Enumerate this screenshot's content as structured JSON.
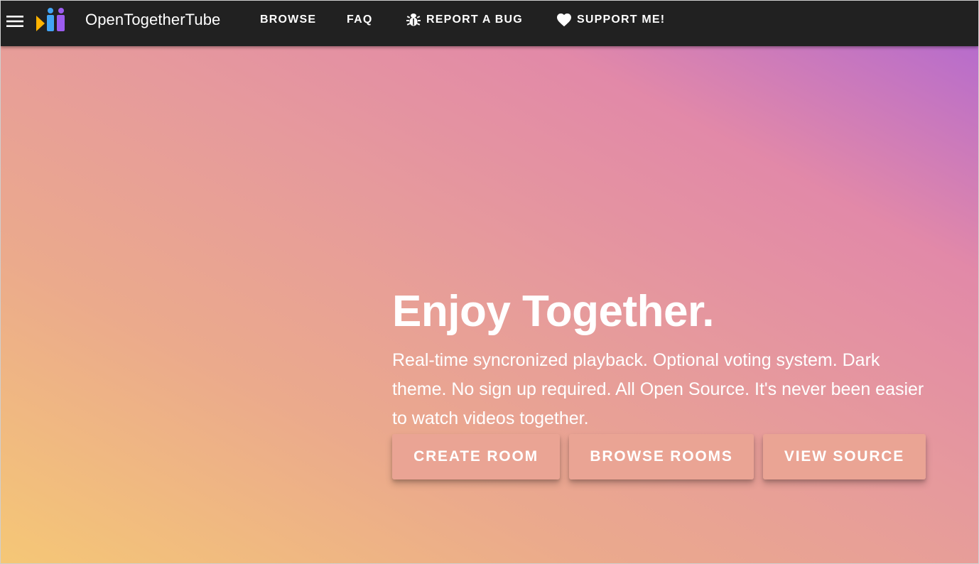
{
  "app": {
    "brand": "OpenTogetherTube"
  },
  "nav": {
    "browse": "BROWSE",
    "faq": "FAQ",
    "report_bug": "REPORT A BUG",
    "support": "SUPPORT ME!"
  },
  "icons": {
    "menu": "hamburger-menu-icon",
    "logo": "opentogethertube-logo",
    "bug": "bug-icon",
    "heart": "heart-icon"
  },
  "hero": {
    "title": "Enjoy Together.",
    "subtitle": "Real-time syncronized playback. Optional voting system. Dark theme. No sign up required. All Open Source. It's never been easier to watch videos together.",
    "buttons": {
      "create_room": "CREATE ROOM",
      "browse_rooms": "BROWSE ROOMS",
      "view_source": "VIEW SOURCE"
    }
  },
  "colors": {
    "topbar": "#212121",
    "gradient_start": "#f5c776",
    "gradient_mid": "#e69a9c",
    "gradient_end": "#b76ccc",
    "button_bg": "#eaa494",
    "logo_yellow": "#ffb300",
    "logo_blue": "#42a5f5",
    "logo_purple": "#9c5cf0"
  }
}
